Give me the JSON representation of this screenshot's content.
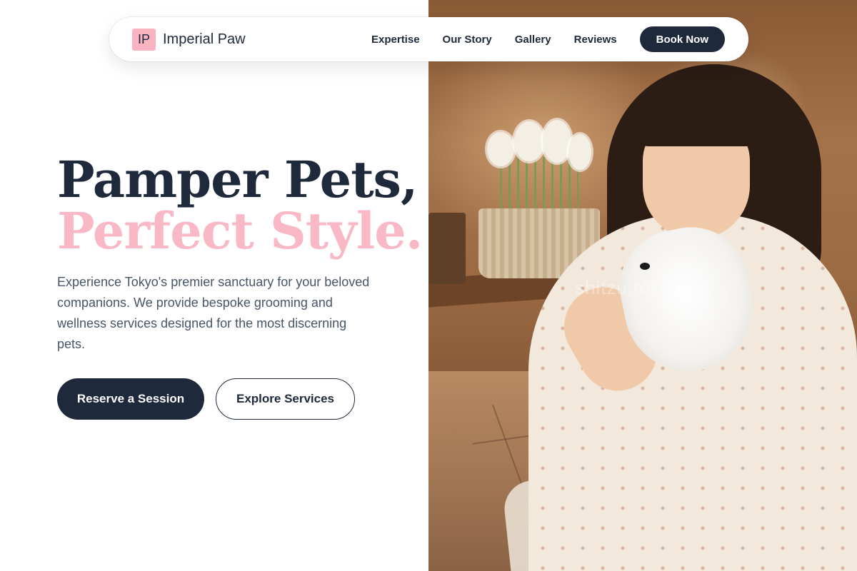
{
  "brand": {
    "mark": "IP",
    "name": "Imperial Paw",
    "mark_color": "#f9b3c1"
  },
  "nav": {
    "links": [
      "Expertise",
      "Our Story",
      "Gallery",
      "Reviews"
    ],
    "cta": "Book Now"
  },
  "hero": {
    "title_line1": "Pamper Pets,",
    "title_line2": "Perfect Style.",
    "description": "Experience Tokyo's premier sanctuary for your beloved companions. We provide bespoke grooming and wellness services designed for the most discerning pets.",
    "primary_cta": "Reserve a Session",
    "secondary_cta": "Explore Services"
  },
  "photo": {
    "watermark": "shitzu.tokyo"
  },
  "colors": {
    "navy": "#1e293b",
    "pink": "#f9b8c6",
    "body_text": "#475569",
    "background": "#ffffff"
  }
}
